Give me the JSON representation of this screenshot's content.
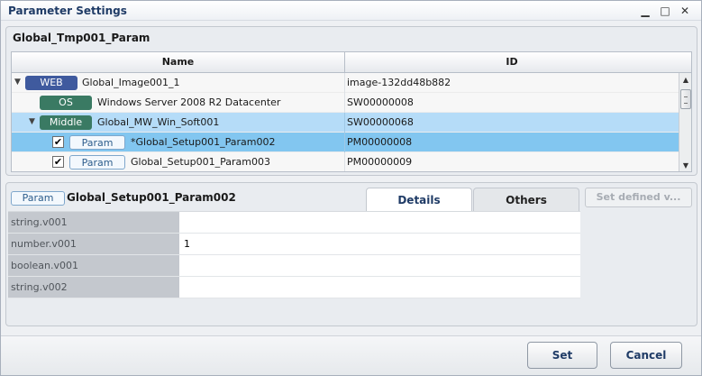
{
  "window": {
    "title": "Parameter Settings",
    "controls": {
      "minimize": "▁",
      "maximize": "□",
      "close": "✕"
    }
  },
  "template": {
    "name": "Global_Tmp001_Param"
  },
  "tree_grid": {
    "columns": {
      "name": "Name",
      "id": "ID"
    },
    "rows": [
      {
        "expander": "▼",
        "tag": "WEB",
        "label": "Global_Image001_1",
        "id": "image-132dd48b882"
      },
      {
        "tag": "OS",
        "label": "Windows Server 2008 R2 Datacenter",
        "id": "SW00000008"
      },
      {
        "expander": "▼",
        "tag": "Middle",
        "label": "Global_MW_Win_Soft001",
        "id": "SW00000068"
      },
      {
        "checked": "✔",
        "tag": "Param",
        "label": "*Global_Setup001_Param002",
        "id": "PM00000008"
      },
      {
        "checked": "✔",
        "tag": "Param",
        "label": "Global_Setup001_Param003",
        "id": "PM00000009"
      }
    ],
    "scroll": {
      "up": "▲",
      "down": "▼"
    }
  },
  "details_panel": {
    "param_tag": "Param",
    "param_name": "Global_Setup001_Param002",
    "tabs": {
      "details": "Details",
      "others": "Others"
    },
    "set_defined_button": "Set defined v...",
    "properties": [
      {
        "label": "string.v001",
        "value": ""
      },
      {
        "label": "number.v001",
        "value": "1"
      },
      {
        "label": "boolean.v001",
        "value": ""
      },
      {
        "label": "string.v002",
        "value": ""
      }
    ]
  },
  "footer": {
    "set": "Set",
    "cancel": "Cancel"
  }
}
